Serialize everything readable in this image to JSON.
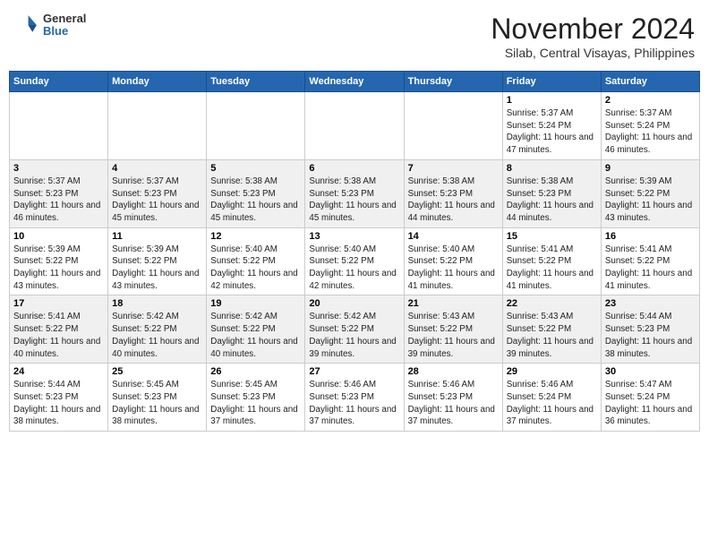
{
  "header": {
    "logo": {
      "general": "General",
      "blue": "Blue"
    },
    "title": "November 2024",
    "location": "Silab, Central Visayas, Philippines"
  },
  "calendar": {
    "days_of_week": [
      "Sunday",
      "Monday",
      "Tuesday",
      "Wednesday",
      "Thursday",
      "Friday",
      "Saturday"
    ],
    "weeks": [
      [
        {
          "day": "",
          "sunrise": "",
          "sunset": "",
          "daylight": ""
        },
        {
          "day": "",
          "sunrise": "",
          "sunset": "",
          "daylight": ""
        },
        {
          "day": "",
          "sunrise": "",
          "sunset": "",
          "daylight": ""
        },
        {
          "day": "",
          "sunrise": "",
          "sunset": "",
          "daylight": ""
        },
        {
          "day": "",
          "sunrise": "",
          "sunset": "",
          "daylight": ""
        },
        {
          "day": "1",
          "sunrise": "Sunrise: 5:37 AM",
          "sunset": "Sunset: 5:24 PM",
          "daylight": "Daylight: 11 hours and 47 minutes."
        },
        {
          "day": "2",
          "sunrise": "Sunrise: 5:37 AM",
          "sunset": "Sunset: 5:24 PM",
          "daylight": "Daylight: 11 hours and 46 minutes."
        }
      ],
      [
        {
          "day": "3",
          "sunrise": "Sunrise: 5:37 AM",
          "sunset": "Sunset: 5:23 PM",
          "daylight": "Daylight: 11 hours and 46 minutes."
        },
        {
          "day": "4",
          "sunrise": "Sunrise: 5:37 AM",
          "sunset": "Sunset: 5:23 PM",
          "daylight": "Daylight: 11 hours and 45 minutes."
        },
        {
          "day": "5",
          "sunrise": "Sunrise: 5:38 AM",
          "sunset": "Sunset: 5:23 PM",
          "daylight": "Daylight: 11 hours and 45 minutes."
        },
        {
          "day": "6",
          "sunrise": "Sunrise: 5:38 AM",
          "sunset": "Sunset: 5:23 PM",
          "daylight": "Daylight: 11 hours and 45 minutes."
        },
        {
          "day": "7",
          "sunrise": "Sunrise: 5:38 AM",
          "sunset": "Sunset: 5:23 PM",
          "daylight": "Daylight: 11 hours and 44 minutes."
        },
        {
          "day": "8",
          "sunrise": "Sunrise: 5:38 AM",
          "sunset": "Sunset: 5:23 PM",
          "daylight": "Daylight: 11 hours and 44 minutes."
        },
        {
          "day": "9",
          "sunrise": "Sunrise: 5:39 AM",
          "sunset": "Sunset: 5:22 PM",
          "daylight": "Daylight: 11 hours and 43 minutes."
        }
      ],
      [
        {
          "day": "10",
          "sunrise": "Sunrise: 5:39 AM",
          "sunset": "Sunset: 5:22 PM",
          "daylight": "Daylight: 11 hours and 43 minutes."
        },
        {
          "day": "11",
          "sunrise": "Sunrise: 5:39 AM",
          "sunset": "Sunset: 5:22 PM",
          "daylight": "Daylight: 11 hours and 43 minutes."
        },
        {
          "day": "12",
          "sunrise": "Sunrise: 5:40 AM",
          "sunset": "Sunset: 5:22 PM",
          "daylight": "Daylight: 11 hours and 42 minutes."
        },
        {
          "day": "13",
          "sunrise": "Sunrise: 5:40 AM",
          "sunset": "Sunset: 5:22 PM",
          "daylight": "Daylight: 11 hours and 42 minutes."
        },
        {
          "day": "14",
          "sunrise": "Sunrise: 5:40 AM",
          "sunset": "Sunset: 5:22 PM",
          "daylight": "Daylight: 11 hours and 41 minutes."
        },
        {
          "day": "15",
          "sunrise": "Sunrise: 5:41 AM",
          "sunset": "Sunset: 5:22 PM",
          "daylight": "Daylight: 11 hours and 41 minutes."
        },
        {
          "day": "16",
          "sunrise": "Sunrise: 5:41 AM",
          "sunset": "Sunset: 5:22 PM",
          "daylight": "Daylight: 11 hours and 41 minutes."
        }
      ],
      [
        {
          "day": "17",
          "sunrise": "Sunrise: 5:41 AM",
          "sunset": "Sunset: 5:22 PM",
          "daylight": "Daylight: 11 hours and 40 minutes."
        },
        {
          "day": "18",
          "sunrise": "Sunrise: 5:42 AM",
          "sunset": "Sunset: 5:22 PM",
          "daylight": "Daylight: 11 hours and 40 minutes."
        },
        {
          "day": "19",
          "sunrise": "Sunrise: 5:42 AM",
          "sunset": "Sunset: 5:22 PM",
          "daylight": "Daylight: 11 hours and 40 minutes."
        },
        {
          "day": "20",
          "sunrise": "Sunrise: 5:42 AM",
          "sunset": "Sunset: 5:22 PM",
          "daylight": "Daylight: 11 hours and 39 minutes."
        },
        {
          "day": "21",
          "sunrise": "Sunrise: 5:43 AM",
          "sunset": "Sunset: 5:22 PM",
          "daylight": "Daylight: 11 hours and 39 minutes."
        },
        {
          "day": "22",
          "sunrise": "Sunrise: 5:43 AM",
          "sunset": "Sunset: 5:22 PM",
          "daylight": "Daylight: 11 hours and 39 minutes."
        },
        {
          "day": "23",
          "sunrise": "Sunrise: 5:44 AM",
          "sunset": "Sunset: 5:23 PM",
          "daylight": "Daylight: 11 hours and 38 minutes."
        }
      ],
      [
        {
          "day": "24",
          "sunrise": "Sunrise: 5:44 AM",
          "sunset": "Sunset: 5:23 PM",
          "daylight": "Daylight: 11 hours and 38 minutes."
        },
        {
          "day": "25",
          "sunrise": "Sunrise: 5:45 AM",
          "sunset": "Sunset: 5:23 PM",
          "daylight": "Daylight: 11 hours and 38 minutes."
        },
        {
          "day": "26",
          "sunrise": "Sunrise: 5:45 AM",
          "sunset": "Sunset: 5:23 PM",
          "daylight": "Daylight: 11 hours and 37 minutes."
        },
        {
          "day": "27",
          "sunrise": "Sunrise: 5:46 AM",
          "sunset": "Sunset: 5:23 PM",
          "daylight": "Daylight: 11 hours and 37 minutes."
        },
        {
          "day": "28",
          "sunrise": "Sunrise: 5:46 AM",
          "sunset": "Sunset: 5:23 PM",
          "daylight": "Daylight: 11 hours and 37 minutes."
        },
        {
          "day": "29",
          "sunrise": "Sunrise: 5:46 AM",
          "sunset": "Sunset: 5:24 PM",
          "daylight": "Daylight: 11 hours and 37 minutes."
        },
        {
          "day": "30",
          "sunrise": "Sunrise: 5:47 AM",
          "sunset": "Sunset: 5:24 PM",
          "daylight": "Daylight: 11 hours and 36 minutes."
        }
      ]
    ]
  }
}
